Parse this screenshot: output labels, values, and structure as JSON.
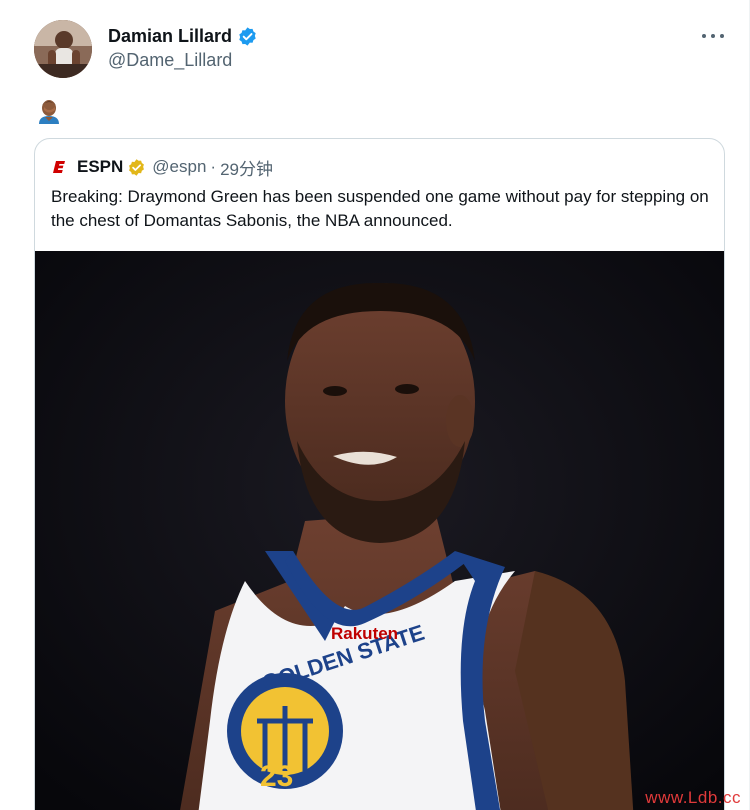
{
  "author": {
    "display_name": "Damian Lillard",
    "handle": "@Dame_Lillard",
    "verified": true
  },
  "tweet": {
    "emoji_icon": "person-facepalming-icon"
  },
  "quoted": {
    "display_name": "ESPN",
    "handle": "@espn",
    "separator": "·",
    "time": "29分钟",
    "text": "Breaking: Draymond Green has been suspended one game without pay for stepping on the chest of Domantas Sabonis, the NBA announced.",
    "media_jersey_team": "GOLDEN STATE",
    "media_jersey_sponsor": "Rakuten",
    "media_jersey_number": "23"
  },
  "watermark": "www.Ldb.cc",
  "colors": {
    "verified_blue": "#1d9bf0",
    "verified_gold": "#e2b719",
    "espn_red": "#d00000",
    "text_primary": "#0f1419",
    "text_secondary": "#536471",
    "border": "#cfd9de"
  }
}
